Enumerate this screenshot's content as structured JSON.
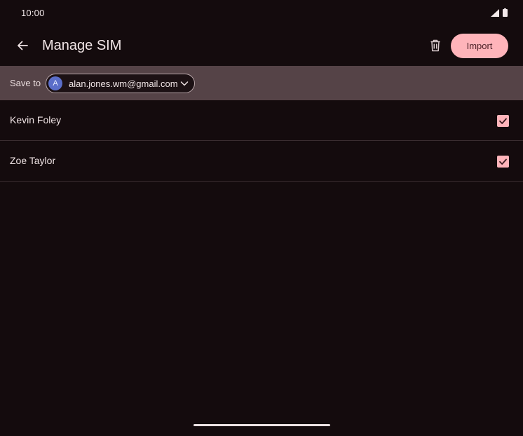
{
  "status_bar": {
    "time": "10:00"
  },
  "app_bar": {
    "title": "Manage SIM",
    "import_label": "Import"
  },
  "save_to": {
    "label": "Save to",
    "avatar_letter": "A",
    "email": "alan.jones.wm@gmail.com"
  },
  "contacts": [
    {
      "name": "Kevin Foley",
      "checked": true
    },
    {
      "name": "Zoe Taylor",
      "checked": true
    }
  ],
  "icons": {
    "back": "arrow-left-icon",
    "delete": "trash-icon",
    "dropdown": "chevron-down-icon",
    "check": "check-icon",
    "signal": "signal-icon",
    "battery": "battery-icon"
  },
  "colors": {
    "background": "#140b0d",
    "accent": "#ffb4ba",
    "save_bar": "#554347",
    "avatar": "#5b6ec9"
  }
}
